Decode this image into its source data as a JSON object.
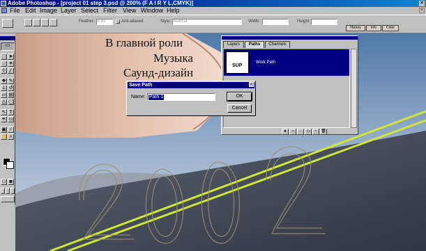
{
  "window": {
    "title": "Adobe Photoshop - [project 01 step 3.psd @ 200% (F A I R Y  L,CMYK)]"
  },
  "menubar": {
    "items": [
      "File",
      "Edit",
      "Image",
      "Layer",
      "Select",
      "Filter",
      "View",
      "Window",
      "Help"
    ]
  },
  "options_bar": {
    "feather_label": "Feather:",
    "feather_value": "0 px",
    "antialias_label": "Anti-aliased",
    "style_label": "Style:",
    "style_value": "Normal",
    "width_label": "Width:",
    "height_label": "Height:",
    "palette_tabs": [
      "History",
      "Info",
      "Color"
    ]
  },
  "canvas": {
    "text_lines": [
      "В главной роли",
      "Музыка",
      "Саунд-дизайн"
    ],
    "year_outline": "2002"
  },
  "paths_panel": {
    "tabs": [
      "Layers",
      "Paths",
      "Channels"
    ],
    "active_tab": "Paths",
    "rows": [
      {
        "name": "Work Path",
        "thumbnail_text": "SUP"
      }
    ]
  },
  "save_path_dialog": {
    "title": "Save Path",
    "name_label": "Name:",
    "name_value": "Path 1",
    "ok_label": "OK",
    "cancel_label": "Cancel"
  },
  "colors": {
    "title_bar": "#000080",
    "face": "#c0c0c0",
    "road_stripe": "#c9e21e"
  }
}
